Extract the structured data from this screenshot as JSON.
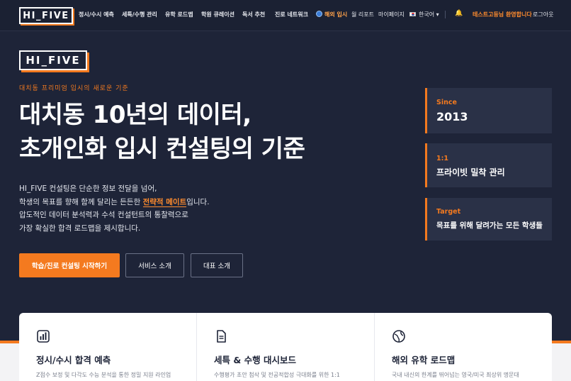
{
  "nav": {
    "logo": "HI_FIVE",
    "items": [
      "정시/수시 예측",
      "세특/수행 관리",
      "유학 로드맵",
      "학원 큐레이션",
      "독서 추천",
      "진로 네트워크"
    ],
    "overseas": "해외 입시",
    "report": "월 리포트",
    "mypage": "마이페이지",
    "language": "한국어 ▾",
    "welcome": "테스트고등님 환영합니다",
    "logout": "로그아웃"
  },
  "hero": {
    "logo": "HI_FIVE",
    "eyebrow": "대치동 프리미엄 입시의 새로운 기준",
    "title_line1": "대치동 10년의 데이터,",
    "title_line2": "초개인화 입시 컨설팅의 기준",
    "desc_line1": "HI_FIVE 컨설팅은 단순한 정보 전달을 넘어,",
    "desc_line2_pre": "학생의 목표를 향해 함께 달리는 든든한 ",
    "desc_line2_hl": "전략적 메이트",
    "desc_line2_post": "입니다.",
    "desc_line3": "압도적인 데이터 분석력과 수석 컨설턴트의 통찰력으로",
    "desc_line4": "가장 확실한 합격 로드맵을 제시합니다.",
    "btn_primary": "학습/진로 컨설팅 시작하기",
    "btn_service": "서비스 소개",
    "btn_ceo": "대표 소개"
  },
  "stats": [
    {
      "label": "Since",
      "value": "2013"
    },
    {
      "label": "1:1",
      "value": "프라이빗 밀착 관리"
    },
    {
      "label": "Target",
      "value": "목표를 위해 달려가는 모든 학생들"
    }
  ],
  "features": [
    {
      "title": "정시/수시 합격 예측",
      "desc": "Z점수 보정 및 다각도 수능 분석을 통한 정밀 지원 라인업",
      "icon": "bar-chart-icon"
    },
    {
      "title": "세특 & 수행 대시보드",
      "desc": "수행평가 초안 첨삭 및 전공적합성 극대화를 위한 1:1",
      "icon": "document-icon"
    },
    {
      "title": "해외 유학 로드맵",
      "desc": "국내 내신의 한계를 뛰어넘는 영국/미국 최상위 명문대",
      "icon": "globe-icon"
    }
  ],
  "colors": {
    "accent": "#f47a1f",
    "background": "#1e2438",
    "card": "#2a3147"
  }
}
